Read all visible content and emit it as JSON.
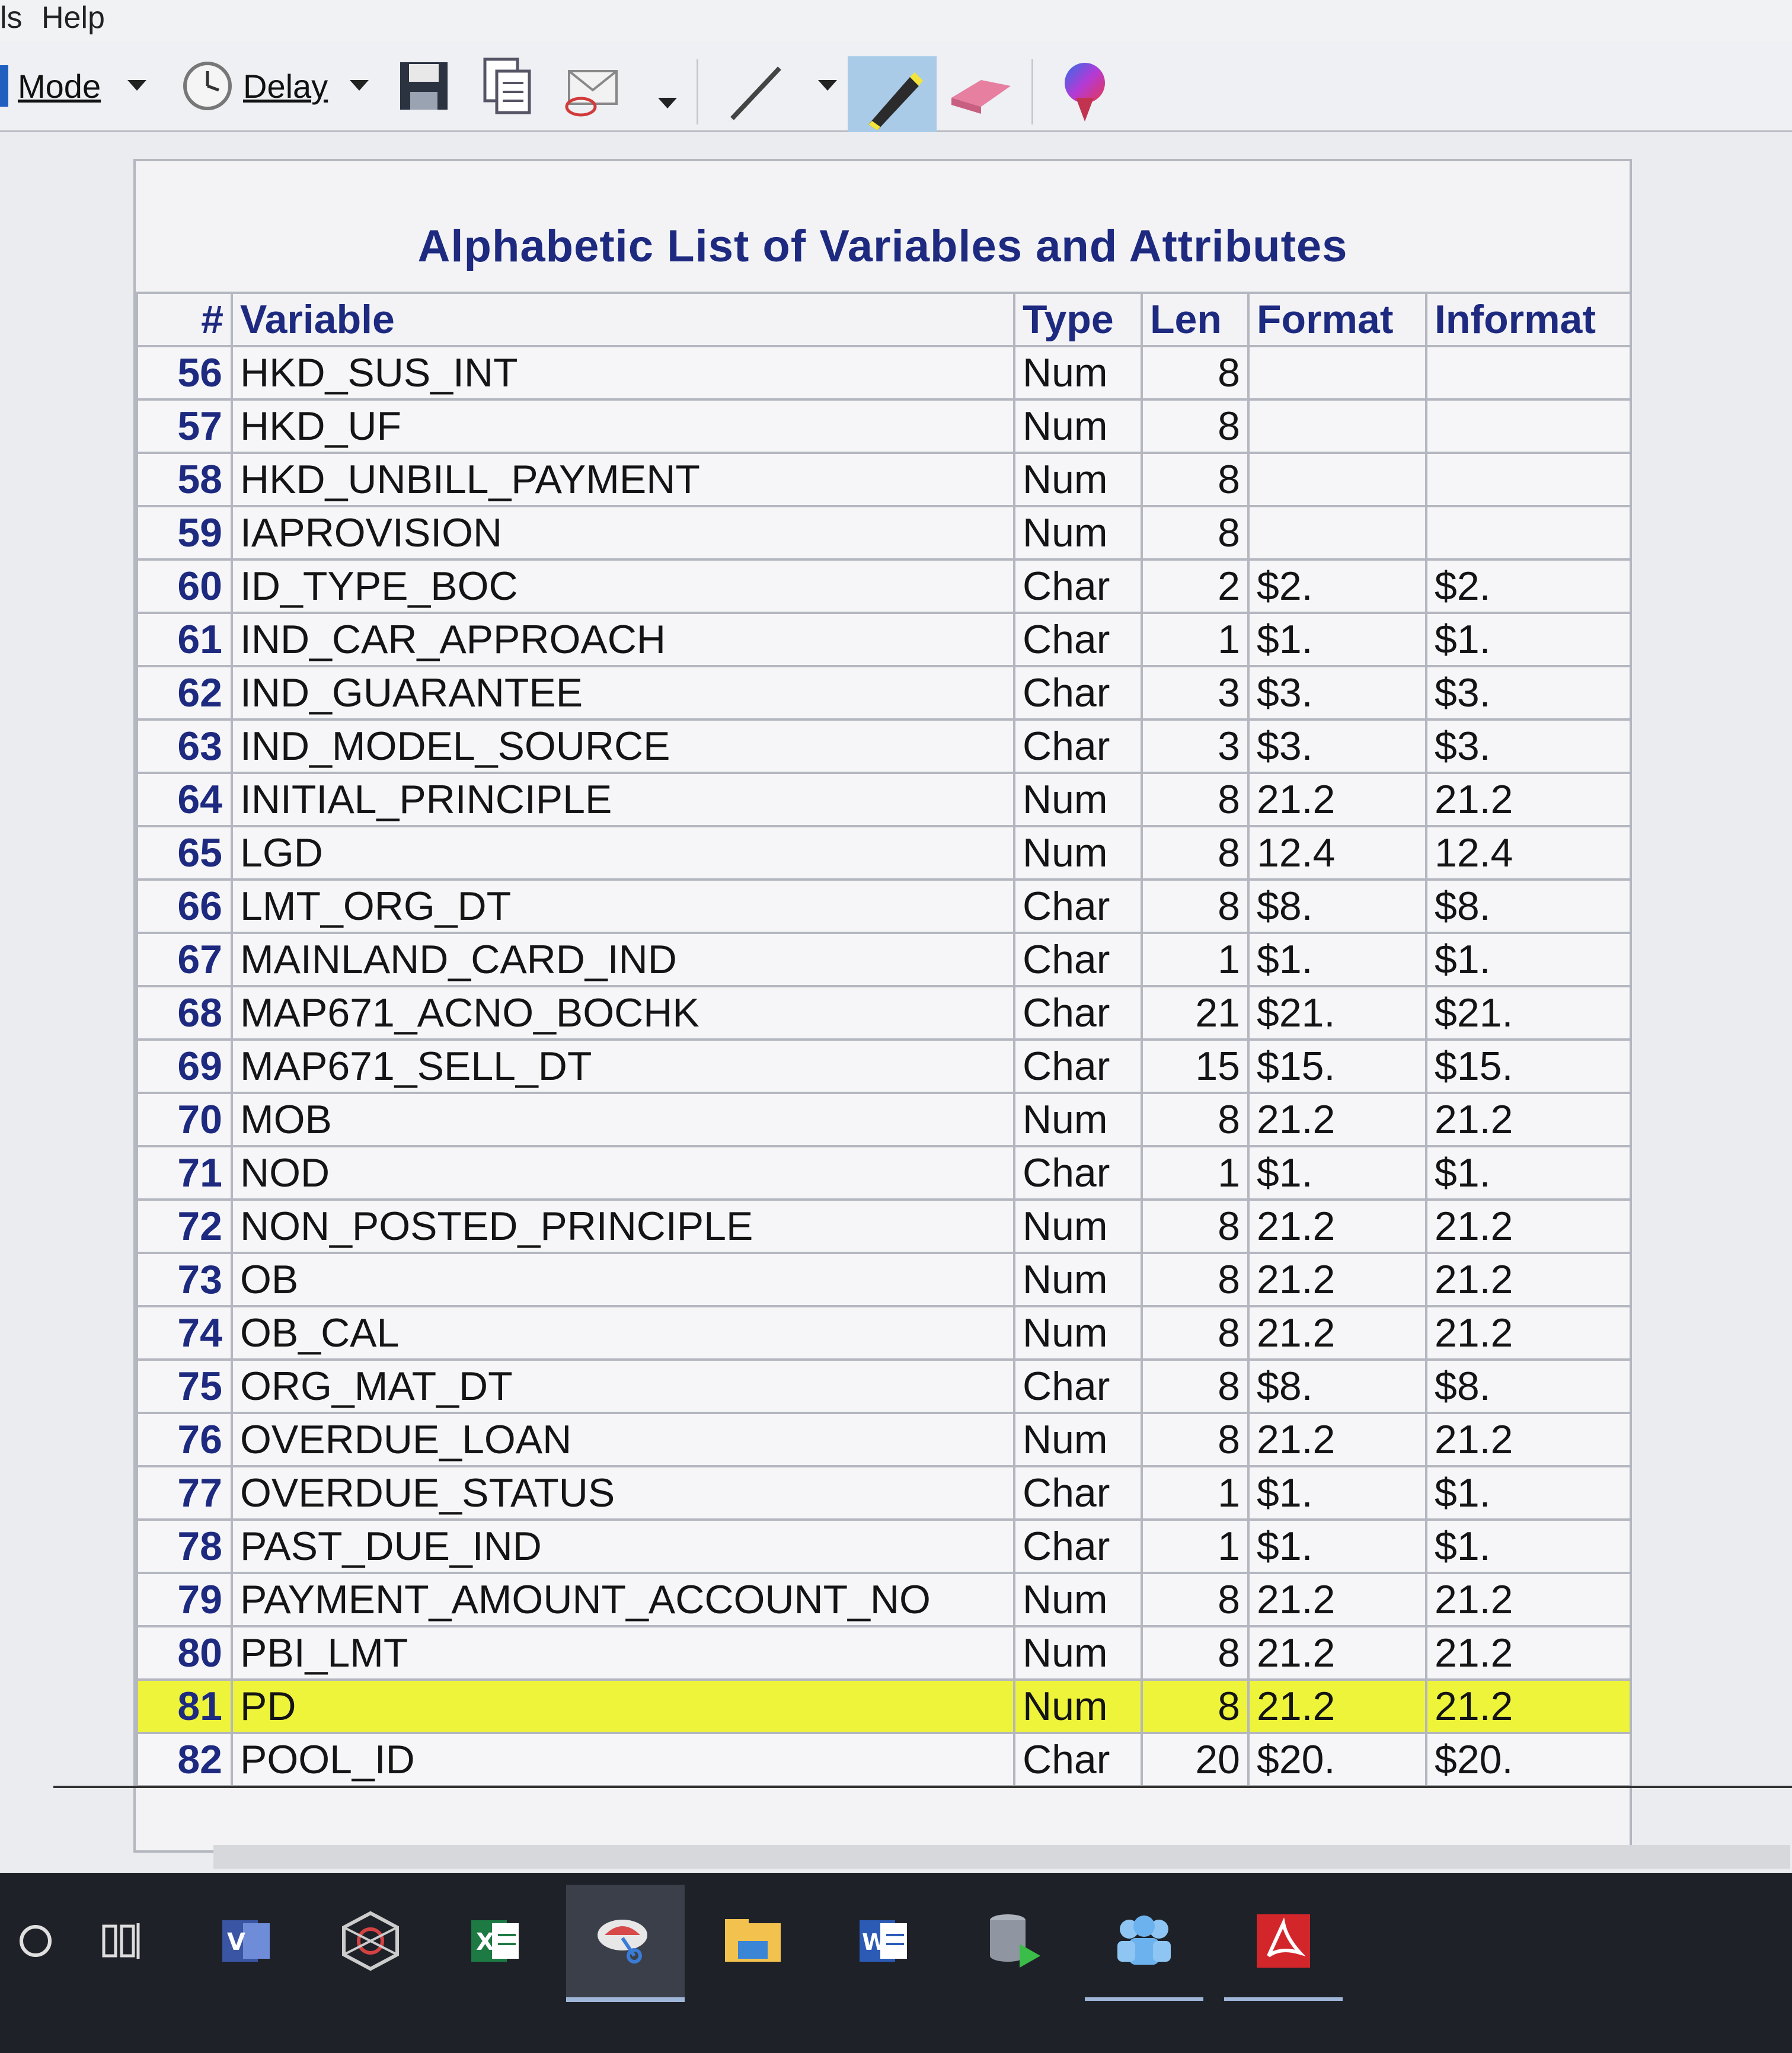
{
  "menu": {
    "left_fragment": "ls",
    "help_label": "Help"
  },
  "toolbar": {
    "mode_label": "Mode",
    "delay_label": "Delay",
    "icons": [
      "clock-icon",
      "save-icon",
      "copy-icon",
      "send-icon",
      "pen-icon",
      "highlighter-icon",
      "eraser-icon",
      "color-icon"
    ],
    "highlight_color": "#eef43a"
  },
  "report": {
    "title": "Alphabetic List of Variables and Attributes",
    "headers": {
      "num": "#",
      "variable": "Variable",
      "type": "Type",
      "len": "Len",
      "format": "Format",
      "informat": "Informat"
    },
    "rows": [
      {
        "num": "56",
        "variable": "HKD_SUS_INT",
        "type": "Num",
        "len": "8",
        "format": "",
        "informat": ""
      },
      {
        "num": "57",
        "variable": "HKD_UF",
        "type": "Num",
        "len": "8",
        "format": "",
        "informat": ""
      },
      {
        "num": "58",
        "variable": "HKD_UNBILL_PAYMENT",
        "type": "Num",
        "len": "8",
        "format": "",
        "informat": ""
      },
      {
        "num": "59",
        "variable": "IAPROVISION",
        "type": "Num",
        "len": "8",
        "format": "",
        "informat": ""
      },
      {
        "num": "60",
        "variable": "ID_TYPE_BOC",
        "type": "Char",
        "len": "2",
        "format": "$2.",
        "informat": "$2."
      },
      {
        "num": "61",
        "variable": "IND_CAR_APPROACH",
        "type": "Char",
        "len": "1",
        "format": "$1.",
        "informat": "$1."
      },
      {
        "num": "62",
        "variable": "IND_GUARANTEE",
        "type": "Char",
        "len": "3",
        "format": "$3.",
        "informat": "$3."
      },
      {
        "num": "63",
        "variable": "IND_MODEL_SOURCE",
        "type": "Char",
        "len": "3",
        "format": "$3.",
        "informat": "$3."
      },
      {
        "num": "64",
        "variable": "INITIAL_PRINCIPLE",
        "type": "Num",
        "len": "8",
        "format": "21.2",
        "informat": "21.2"
      },
      {
        "num": "65",
        "variable": "LGD",
        "type": "Num",
        "len": "8",
        "format": "12.4",
        "informat": "12.4"
      },
      {
        "num": "66",
        "variable": "LMT_ORG_DT",
        "type": "Char",
        "len": "8",
        "format": "$8.",
        "informat": "$8."
      },
      {
        "num": "67",
        "variable": "MAINLAND_CARD_IND",
        "type": "Char",
        "len": "1",
        "format": "$1.",
        "informat": "$1."
      },
      {
        "num": "68",
        "variable": "MAP671_ACNO_BOCHK",
        "type": "Char",
        "len": "21",
        "format": "$21.",
        "informat": "$21."
      },
      {
        "num": "69",
        "variable": "MAP671_SELL_DT",
        "type": "Char",
        "len": "15",
        "format": "$15.",
        "informat": "$15."
      },
      {
        "num": "70",
        "variable": "MOB",
        "type": "Num",
        "len": "8",
        "format": "21.2",
        "informat": "21.2"
      },
      {
        "num": "71",
        "variable": "NOD",
        "type": "Char",
        "len": "1",
        "format": "$1.",
        "informat": "$1."
      },
      {
        "num": "72",
        "variable": "NON_POSTED_PRINCIPLE",
        "type": "Num",
        "len": "8",
        "format": "21.2",
        "informat": "21.2"
      },
      {
        "num": "73",
        "variable": "OB",
        "type": "Num",
        "len": "8",
        "format": "21.2",
        "informat": "21.2"
      },
      {
        "num": "74",
        "variable": "OB_CAL",
        "type": "Num",
        "len": "8",
        "format": "21.2",
        "informat": "21.2"
      },
      {
        "num": "75",
        "variable": "ORG_MAT_DT",
        "type": "Char",
        "len": "8",
        "format": "$8.",
        "informat": "$8."
      },
      {
        "num": "76",
        "variable": "OVERDUE_LOAN",
        "type": "Num",
        "len": "8",
        "format": "21.2",
        "informat": "21.2"
      },
      {
        "num": "77",
        "variable": "OVERDUE_STATUS",
        "type": "Char",
        "len": "1",
        "format": "$1.",
        "informat": "$1."
      },
      {
        "num": "78",
        "variable": "PAST_DUE_IND",
        "type": "Char",
        "len": "1",
        "format": "$1.",
        "informat": "$1."
      },
      {
        "num": "79",
        "variable": "PAYMENT_AMOUNT_ACCOUNT_NO",
        "type": "Num",
        "len": "8",
        "format": "21.2",
        "informat": "21.2"
      },
      {
        "num": "80",
        "variable": "PBI_LMT",
        "type": "Num",
        "len": "8",
        "format": "21.2",
        "informat": "21.2"
      },
      {
        "num": "81",
        "variable": "PD",
        "type": "Num",
        "len": "8",
        "format": "21.2",
        "informat": "21.2",
        "highlighted": true
      },
      {
        "num": "82",
        "variable": "POOL_ID",
        "type": "Char",
        "len": "20",
        "format": "$20.",
        "informat": "$20."
      }
    ]
  },
  "taskbar": {
    "items": [
      "search-icon",
      "task-view-icon",
      "visio-icon",
      "network-app-icon",
      "excel-icon",
      "snipping-tool-icon",
      "file-explorer-icon",
      "word-icon",
      "database-icon",
      "teams-icon",
      "acrobat-icon"
    ]
  }
}
